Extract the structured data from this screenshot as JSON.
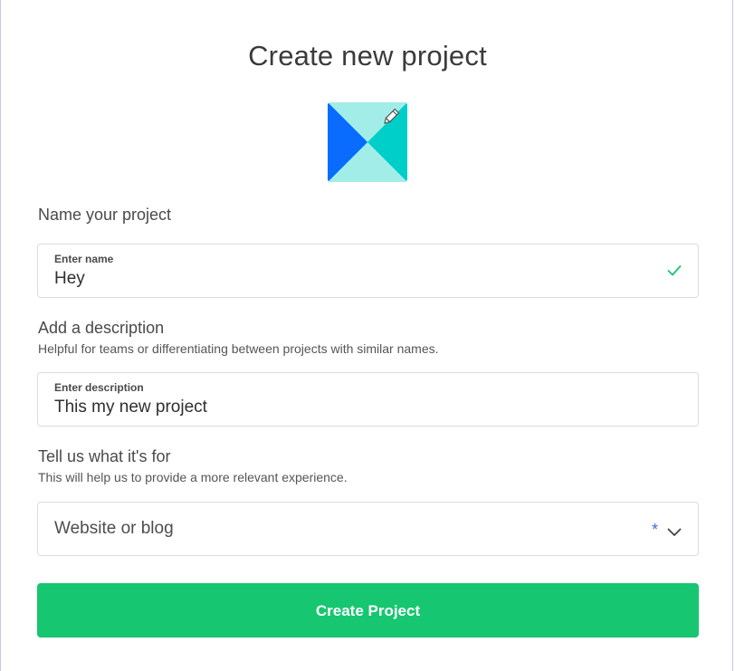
{
  "header": {
    "title": "Create new project"
  },
  "icon": {
    "name": "project-avatar",
    "edit_icon": "pencil-icon",
    "colors": [
      "#0a6cff",
      "#a3ede9",
      "#00cec8"
    ]
  },
  "name_section": {
    "label": "Name your project",
    "field_label": "Enter name",
    "value": "Hey",
    "valid_icon": "check-icon"
  },
  "description_section": {
    "label": "Add a description",
    "help": "Helpful for teams or differentiating between projects with similar names.",
    "field_label": "Enter description",
    "value": "This my new project"
  },
  "purpose_section": {
    "label": "Tell us what it's for",
    "help": "This will help us to provide a more relevant experience.",
    "selected": "Website or blog",
    "required_mark": "*",
    "dropdown_icon": "chevron-down-icon"
  },
  "actions": {
    "create_label": "Create Project",
    "accent": "#17c671"
  }
}
